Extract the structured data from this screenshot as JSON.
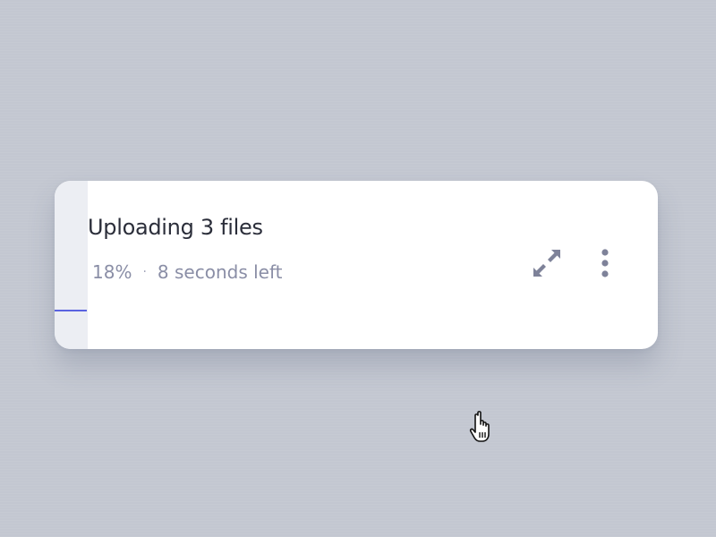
{
  "upload": {
    "title": "Uploading 3 files",
    "percent_label": "18%",
    "separator": "·",
    "time_left": "8 seconds left",
    "progress_fraction": 0.18
  },
  "icons": {
    "expand": "expand-arrows-icon",
    "more": "vertical-ellipsis-icon",
    "cursor": "hand-pointer-cursor-icon"
  },
  "colors": {
    "background": "#c3c7d1",
    "card": "#ffffff",
    "progress": "#5a63e0",
    "title": "#2b2e3a",
    "muted_text": "#8a8ea6",
    "icon": "#7e8299"
  }
}
